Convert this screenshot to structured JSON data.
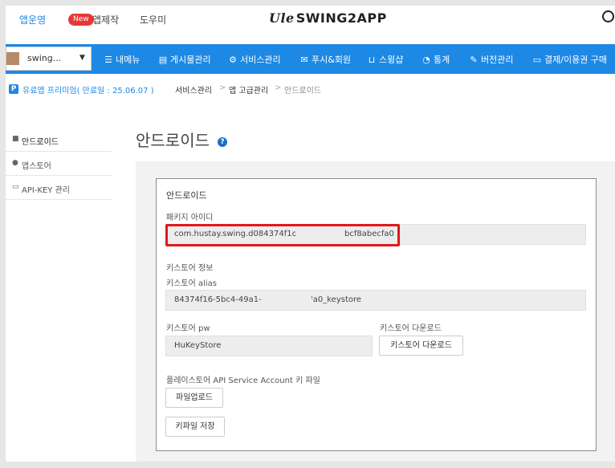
{
  "top": {
    "app_run": "앱운영",
    "new_badge": "New",
    "app_make": "앱제작",
    "help": "도우미",
    "logo_mark": "Ule",
    "logo_text": "SWING2APP"
  },
  "nav": {
    "app_name": "swing...",
    "items": [
      "내메뉴",
      "게시물관리",
      "서비스관리",
      "푸시&회원",
      "스윙샵",
      "통계",
      "버전관리",
      "결제/이용권 구매"
    ]
  },
  "breadcrumb": {
    "premium": "유료앱 프리미엄( 만료일 : 25.06.07 )",
    "items": [
      "서비스관리",
      "앱 고급관리",
      "안드로이드"
    ]
  },
  "sidebar": {
    "items": [
      "안드로이드",
      "앱스토어",
      "API-KEY 관리"
    ]
  },
  "main": {
    "title": "안드로이드",
    "section_title": "안드로이드",
    "package_label": "패키지 아이디",
    "package_value_left": "com.hustay.swing.d084374f1c",
    "package_value_right": "bcf8abecfa0",
    "keystore_info_label": "키스토어 정보",
    "alias_label": "키스토어 alias",
    "alias_value_left": "84374f16-5bc4-49a1-",
    "alias_value_right": "'a0_keystore",
    "pw_label": "키스토어 pw",
    "pw_value": "HuKeyStore",
    "download_label": "키스토어 다운로드",
    "download_button": "키스토어 다운로드",
    "play_key_label": "플레이스토어 API Service Account 키 파일",
    "upload_button": "파일업로드",
    "save_button": "키파일 저장"
  }
}
